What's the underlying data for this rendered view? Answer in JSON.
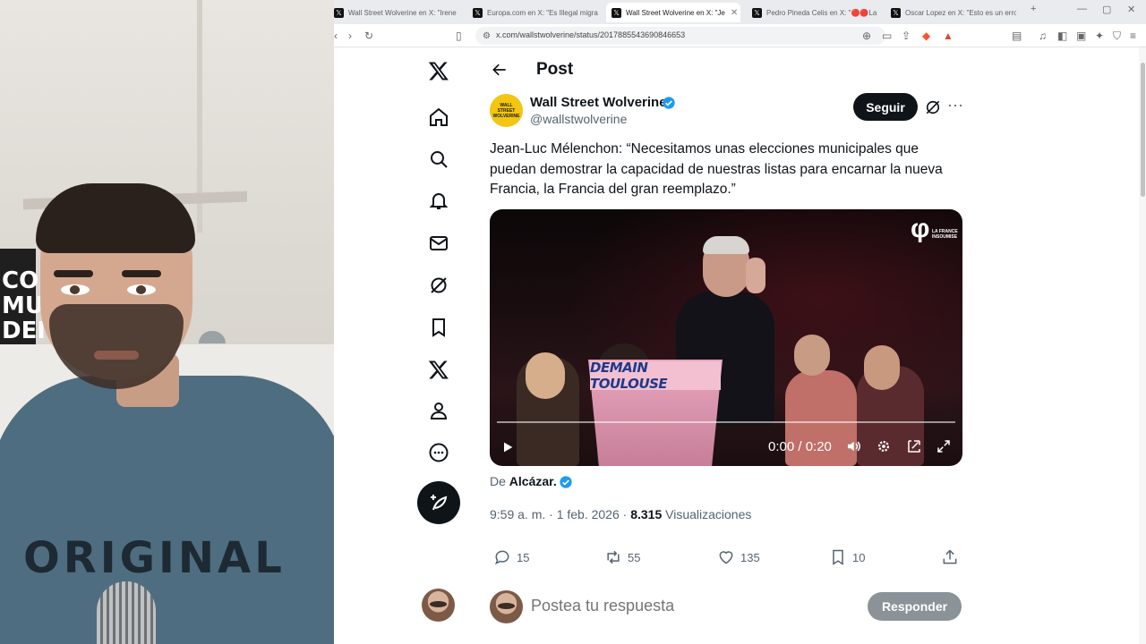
{
  "webcam": {
    "book_text": "CO\nMUE\nDEMOCRA",
    "shirt_text": "ORIGINAL"
  },
  "browser": {
    "tabs": [
      {
        "label": "Wall Street Wolverine en X: \"Irene",
        "icon": "x-logo-icon",
        "active": false
      },
      {
        "label": "Europa.com en X: \"Es Illegal migra",
        "icon": "x-logo-icon",
        "active": false
      },
      {
        "label": "Wall Street Wolverine en X: \"Je",
        "icon": "x-logo-icon",
        "active": true
      },
      {
        "label": "Pedro Pineda Celis en X: \"🔴🔴La",
        "icon": "x-logo-icon",
        "active": false
      },
      {
        "label": "Oscar Lopez en X: \"Esto es un erro",
        "icon": "x-logo-icon",
        "active": false
      }
    ],
    "new_tab": "+",
    "url": "x.com/wallstwolverine/status/2017885543690846653"
  },
  "post_header": {
    "title": "Post"
  },
  "author": {
    "avatar_text": [
      "WALL",
      "STREET",
      "WOLVERINE"
    ],
    "name": "Wall Street Wolverine",
    "handle": "@wallstwolverine",
    "follow_label": "Seguir",
    "verified_color": "#1d9bf0"
  },
  "post": {
    "text": "Jean-Luc Mélenchon: “Necesitamos unas elecciones municipales que puedan demostrar la capacidad de nuestras listas para encarnar la nueva Francia, la Francia del gran reemplazo.”"
  },
  "video": {
    "podium_text": "DEMAIN TOULOUSE",
    "logo_text": "LA FRANCE INSOUMISE",
    "time": "0:00 / 0:20",
    "progress": 0
  },
  "source": {
    "prefix": "De",
    "name": "Alcázar."
  },
  "meta": {
    "time_date": "9:59 a. m. · 1 feb. 2026 · ",
    "views_count": "8.315",
    "views_label": " Visualizaciones"
  },
  "actions": {
    "replies": "15",
    "reposts": "55",
    "likes": "135",
    "bookmarks": "10"
  },
  "reply": {
    "placeholder": "Postea tu respuesta",
    "button_label": "Responder"
  },
  "colors": {
    "accent": "#1d9bf0",
    "text_primary": "#0f1419",
    "text_secondary": "#536471",
    "follow_bg": "#0f1419",
    "reply_btn_bg": "#8b9398"
  }
}
